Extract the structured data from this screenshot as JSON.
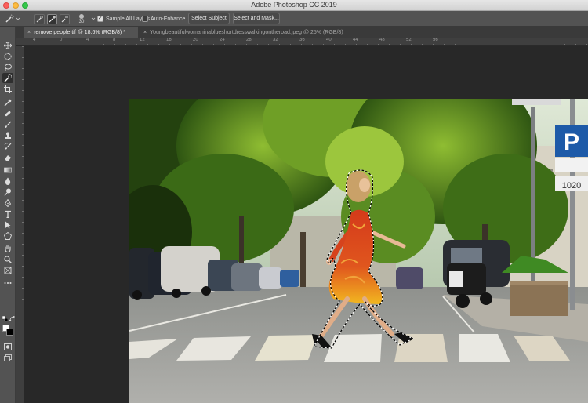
{
  "window": {
    "app_title": "Adobe Photoshop CC 2019"
  },
  "options_bar": {
    "brush_size": "30",
    "sample_all_layers_label": "Sample All Layers",
    "sample_all_layers_checked": true,
    "auto_enhance_label": "Auto-Enhance",
    "auto_enhance_checked": false,
    "select_subject_label": "Select Subject",
    "select_and_mask_label": "Select and Mask..."
  },
  "tabs": [
    {
      "label": "remove people.tif @ 18.6% (RGB/8) *",
      "active": true
    },
    {
      "label": "Youngbeautifulwomaninablueshortdresswalkingontheroad.jpeg @ 25% (RGB/8)",
      "active": false
    }
  ],
  "ruler": {
    "labels": [
      "4",
      "0",
      "4",
      "8",
      "12",
      "16",
      "20",
      "24",
      "28",
      "32",
      "36",
      "40",
      "44",
      "48",
      "52",
      "56"
    ]
  },
  "toolbar": {
    "tools": [
      "move-icon",
      "marquee-icon",
      "lasso-icon",
      "quick-selection-icon",
      "crop-icon",
      "eyedropper-icon",
      "healing-brush-icon",
      "brush-icon",
      "clone-stamp-icon",
      "history-brush-icon",
      "eraser-icon",
      "gradient-icon",
      "blur-icon",
      "dodge-icon",
      "pen-icon",
      "type-icon",
      "path-selection-icon",
      "rectangle-icon",
      "hand-icon",
      "zoom-icon",
      "frame-icon",
      "more-tools-icon"
    ],
    "selected_tool": "quick-selection-icon"
  },
  "canvas": {
    "sign_parking_letter": "P",
    "sign_number": "1020",
    "colors": {
      "sky": "#c8d6c0",
      "foliage_dark": "#1f3a10",
      "foliage_light": "#7fae2a",
      "road": "#9c9c98",
      "dress_red": "#d8401c",
      "dress_yellow": "#f2b820",
      "sign_blue": "#1d5aa8"
    }
  }
}
